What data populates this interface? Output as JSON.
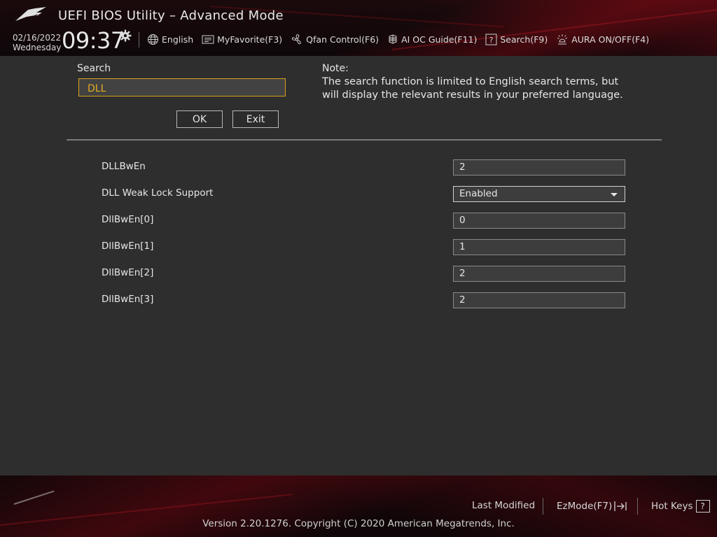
{
  "header": {
    "title": "UEFI BIOS Utility – Advanced Mode",
    "date": "02/16/2022",
    "weekday": "Wednesday",
    "time": "09:37",
    "nav": [
      {
        "label": "English",
        "icon": "globe-icon"
      },
      {
        "label": "MyFavorite(F3)",
        "icon": "favorite-icon"
      },
      {
        "label": "Qfan Control(F6)",
        "icon": "fan-icon"
      },
      {
        "label": "AI OC Guide(F11)",
        "icon": "chip-icon"
      },
      {
        "label": "Search(F9)",
        "icon": "search-question-icon"
      },
      {
        "label": "AURA ON/OFF(F4)",
        "icon": "aura-icon"
      }
    ]
  },
  "search": {
    "label": "Search",
    "value": "DLL",
    "ok_label": "OK",
    "exit_label": "Exit",
    "note_title": "Note:",
    "note_text": "The search function is limited to English search terms, but will display the relevant results in your preferred language."
  },
  "results": [
    {
      "label": "DLLBwEn",
      "value": "2",
      "type": "input"
    },
    {
      "label": "DLL Weak Lock Support",
      "value": "Enabled",
      "type": "select"
    },
    {
      "label": "DllBwEn[0]",
      "value": "0",
      "type": "input"
    },
    {
      "label": "DllBwEn[1]",
      "value": "1",
      "type": "input"
    },
    {
      "label": "DllBwEn[2]",
      "value": "2",
      "type": "input"
    },
    {
      "label": "DllBwEn[3]",
      "value": "2",
      "type": "input"
    }
  ],
  "footer": {
    "last_modified": "Last Modified",
    "ezmode": "EzMode(F7)",
    "hotkeys": "Hot Keys",
    "hotkeys_glyph": "?",
    "version": "Version 2.20.1276. Copyright (C) 2020 American Megatrends, Inc."
  },
  "colors": {
    "accent": "#d9a21a",
    "background": "#2e2e2e",
    "header_red": "#7a0a14"
  }
}
